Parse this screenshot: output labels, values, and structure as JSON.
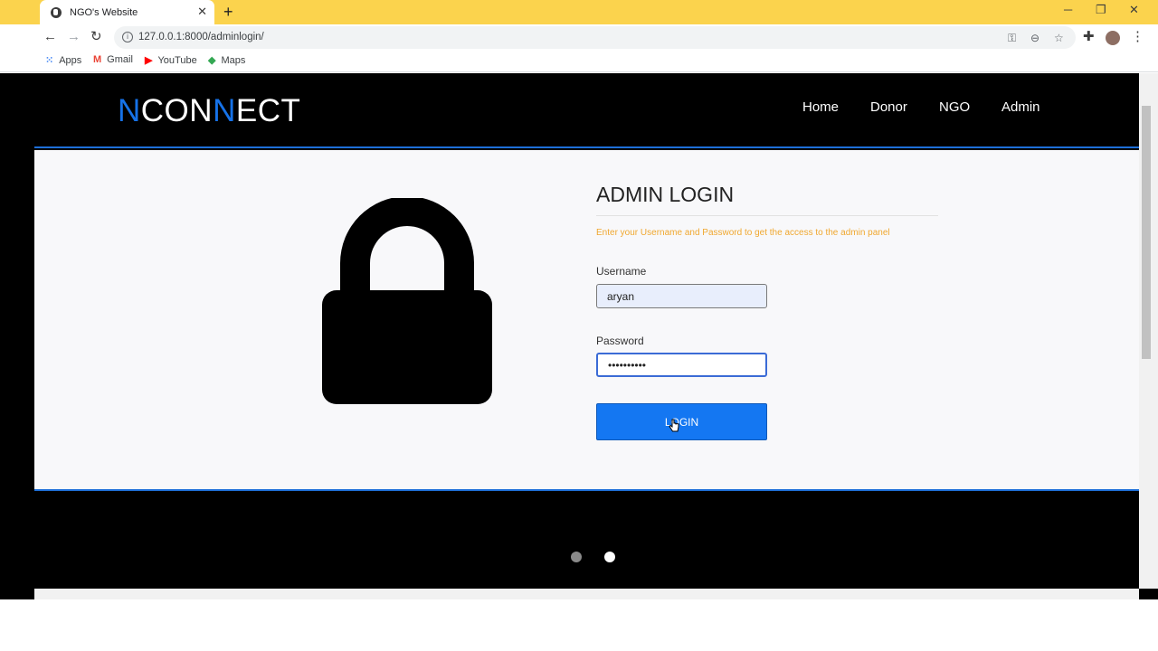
{
  "browser": {
    "tab_title": "NGO's Website",
    "url": "127.0.0.1:8000/adminlogin/",
    "bookmarks": [
      {
        "label": "Apps",
        "icon": "apps-grid-icon",
        "color": "#4285f4"
      },
      {
        "label": "Gmail",
        "icon": "gmail-icon",
        "color": "#ea4335"
      },
      {
        "label": "YouTube",
        "icon": "youtube-icon",
        "color": "#ff0000"
      },
      {
        "label": "Maps",
        "icon": "maps-icon",
        "color": "#34a853"
      }
    ]
  },
  "site": {
    "logo_parts": [
      "N",
      "CON",
      "N",
      "ECT"
    ],
    "nav": [
      "Home",
      "Donor",
      "NGO",
      "Admin"
    ],
    "accent": "#1672e8"
  },
  "login": {
    "title": "ADMIN LOGIN",
    "description": "Enter your Username and Password to get the access to the admin panel",
    "username_label": "Username",
    "username_value": "aryan",
    "password_label": "Password",
    "password_value": "••••••••••",
    "button_label": "LOGIN",
    "description_color": "#f0a830",
    "button_color": "#1477f2"
  },
  "carousel": {
    "slide_count": 2,
    "active_slide": 2
  }
}
